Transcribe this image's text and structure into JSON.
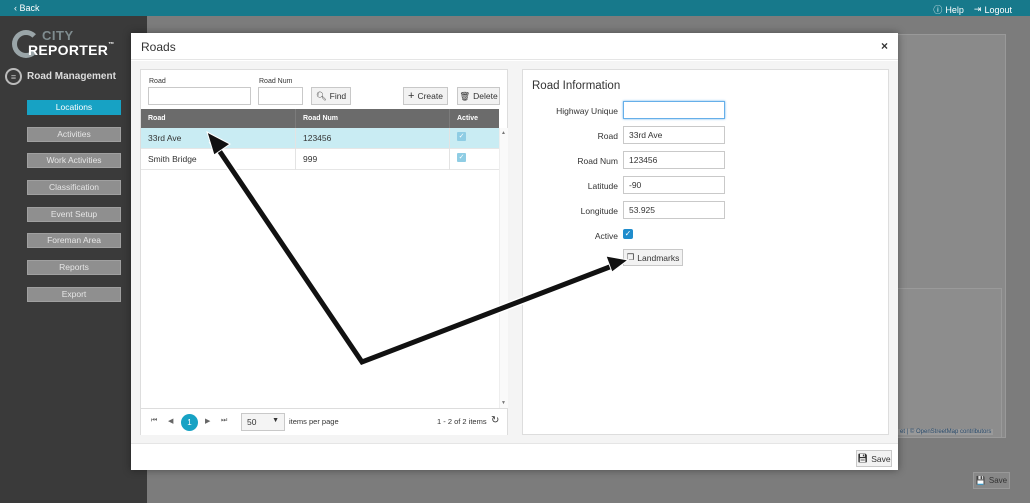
{
  "topbar": {
    "back": "‹ Back",
    "help": "Help",
    "logout": "Logout"
  },
  "logo": {
    "line1": "CITY",
    "line2": "REPORTER",
    "tm": "™"
  },
  "sidebar": {
    "section": "Road Management",
    "items": [
      {
        "label": "Locations",
        "active": true
      },
      {
        "label": "Activities"
      },
      {
        "label": "Work Activities"
      },
      {
        "label": "Classification"
      },
      {
        "label": "Event Setup"
      },
      {
        "label": "Foreman Area"
      },
      {
        "label": "Reports"
      },
      {
        "label": "Export"
      }
    ]
  },
  "background": {
    "attribution": "et | © OpenStreetMap contributors",
    "save": "Save"
  },
  "modal": {
    "title": "Roads",
    "close": "×",
    "save": "Save",
    "search": {
      "road_label": "Road",
      "road_value": "",
      "roadnum_label": "Road Num",
      "roadnum_value": "",
      "find": "Find",
      "create": "Create",
      "delete": "Delete"
    },
    "grid": {
      "columns": [
        "Road",
        "Road Num",
        "Active"
      ],
      "rows": [
        {
          "road": "33rd Ave",
          "num": "123456",
          "active": "✓"
        },
        {
          "road": "Smith Bridge",
          "num": "999",
          "active": "✓"
        }
      ]
    },
    "pager": {
      "page": "1",
      "page_size": "50",
      "items_per_page": "items per page",
      "summary": "1 - 2 of 2 items"
    },
    "info": {
      "title": "Road Information",
      "highway_label": "Highway Unique",
      "highway_value": "",
      "road_label": "Road",
      "road_value": "33rd Ave",
      "roadnum_label": "Road Num",
      "roadnum_value": "123456",
      "lat_label": "Latitude",
      "lat_value": "-90",
      "lon_label": "Longitude",
      "lon_value": "53.925",
      "active_label": "Active",
      "active_check": "✓",
      "landmarks": "Landmarks"
    }
  },
  "colors": {
    "accent": "#17a2c4",
    "topbar": "#17798b",
    "header": "#6b6b6b"
  }
}
